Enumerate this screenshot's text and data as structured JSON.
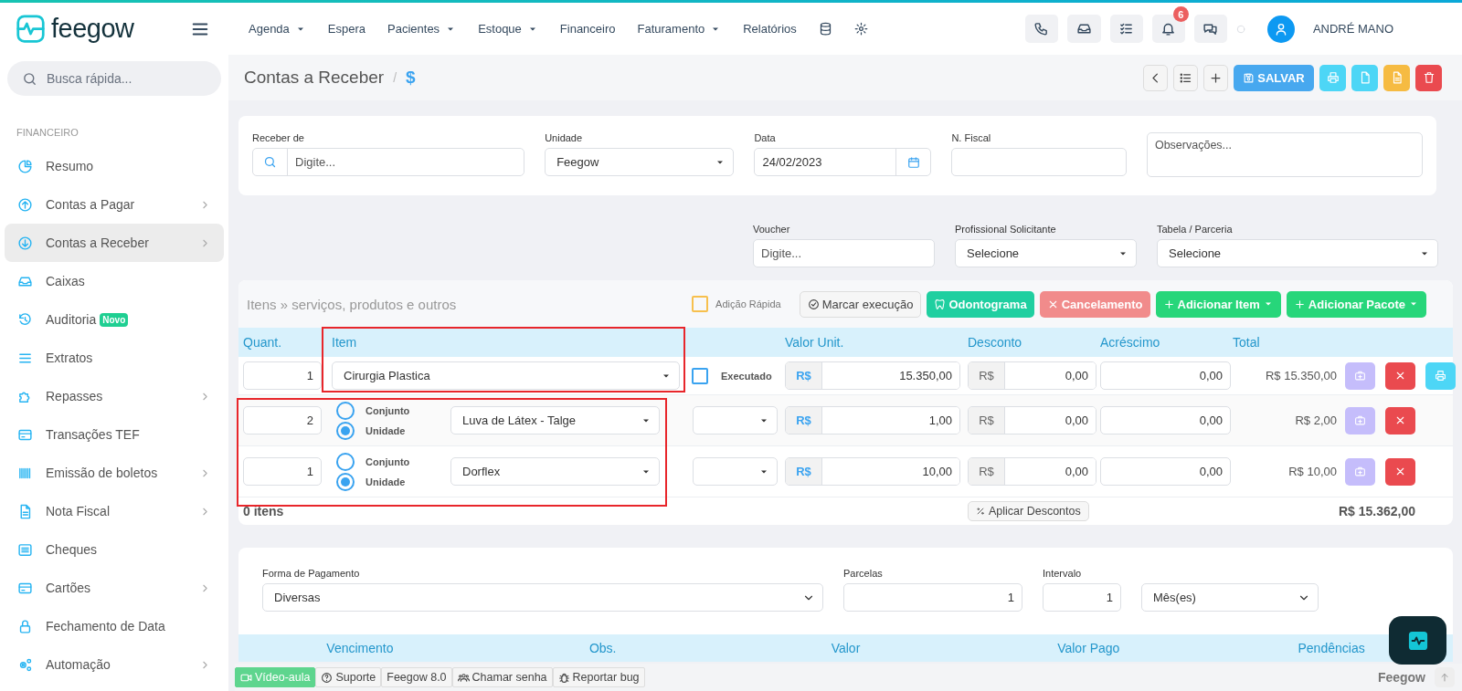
{
  "header": {
    "logo": "feegow",
    "nav": [
      {
        "label": "Agenda",
        "dropdown": true
      },
      {
        "label": "Espera",
        "dropdown": false
      },
      {
        "label": "Pacientes",
        "dropdown": true
      },
      {
        "label": "Estoque",
        "dropdown": true
      },
      {
        "label": "Financeiro",
        "dropdown": false
      },
      {
        "label": "Faturamento",
        "dropdown": true
      },
      {
        "label": "Relatórios",
        "dropdown": false
      }
    ],
    "notification_count": "6",
    "user": "ANDRÉ MANO"
  },
  "sidebar": {
    "search_placeholder": "Busca rápida...",
    "section": "FINANCEIRO",
    "items": [
      {
        "label": "Resumo",
        "selected": false,
        "submenu": false
      },
      {
        "label": "Contas a Pagar",
        "selected": false,
        "submenu": true
      },
      {
        "label": "Contas a Receber",
        "selected": true,
        "submenu": true
      },
      {
        "label": "Caixas",
        "selected": false,
        "submenu": false
      },
      {
        "label": "Auditoria",
        "selected": false,
        "submenu": false,
        "badge": "Novo"
      },
      {
        "label": "Extratos",
        "selected": false,
        "submenu": false
      },
      {
        "label": "Repasses",
        "selected": false,
        "submenu": true
      },
      {
        "label": "Transações TEF",
        "selected": false,
        "submenu": false
      },
      {
        "label": "Emissão de boletos",
        "selected": false,
        "submenu": true
      },
      {
        "label": "Nota Fiscal",
        "selected": false,
        "submenu": true
      },
      {
        "label": "Cheques",
        "selected": false,
        "submenu": false
      },
      {
        "label": "Cartões",
        "selected": false,
        "submenu": true
      },
      {
        "label": "Fechamento de Data",
        "selected": false,
        "submenu": false
      },
      {
        "label": "Automação",
        "selected": false,
        "submenu": true
      }
    ]
  },
  "breadcrumb": {
    "title": "Contas a Receber",
    "separator": "/",
    "current": "$"
  },
  "toolbar": {
    "save_label": "SALVAR"
  },
  "receipt_form": {
    "fields": [
      {
        "label": "Receber de",
        "kind": "search",
        "placeholder": "Digite..."
      },
      {
        "label": "Unidade",
        "kind": "select",
        "value": "Feegow"
      },
      {
        "label": "Data",
        "kind": "date",
        "value": "24/02/2023"
      },
      {
        "label": "N. Fiscal",
        "kind": "text"
      },
      {
        "kind": "textarea",
        "placeholder": "Observações..."
      }
    ]
  },
  "extra_fields": [
    {
      "label": "Voucher",
      "kind": "text",
      "placeholder": "Digite..."
    },
    {
      "label": "Profissional Solicitante",
      "kind": "select",
      "value": "Selecione"
    },
    {
      "label": "Tabela / Parceria",
      "kind": "select",
      "value": "Selecione"
    }
  ],
  "items": {
    "title": "Itens » serviços, produtos e outros",
    "quick_add": {
      "label": "Adição Rápida",
      "checked": false
    },
    "buttons": [
      {
        "label": "Marcar execução",
        "kind": "mark",
        "dropdown": false
      },
      {
        "label": "Odontograma",
        "kind": "tooth",
        "dropdown": false
      },
      {
        "label": "Cancelamento",
        "kind": "cancel",
        "dropdown": false
      },
      {
        "label": "Adicionar Item",
        "kind": "add",
        "dropdown": true
      },
      {
        "label": "Adicionar Pacote",
        "kind": "add",
        "dropdown": true
      }
    ],
    "columns": [
      "Quant.",
      "Item",
      "Valor Unit.",
      "Desconto",
      "Acréscimo",
      "Total"
    ],
    "rows": [
      {
        "kind": "service",
        "quantity": "1",
        "item": "Cirurgia Plastica",
        "executed": false,
        "executed_label": "Executado",
        "currency": "R$",
        "unit_value": "15.350,00",
        "discount_currency": "R$",
        "discount": "0,00",
        "surcharge": "0,00",
        "total": "R$ 15.350,00",
        "actions": [
          {
            "kind": "kit"
          },
          {
            "kind": "remove"
          },
          {
            "kind": "print"
          }
        ]
      },
      {
        "kind": "product",
        "quantity": "2",
        "options": [
          {
            "label": "Conjunto",
            "selected": false
          },
          {
            "label": "Unidade",
            "selected": true
          }
        ],
        "product": "Luva de Látex - Talge",
        "currency": "R$",
        "unit_value": "1,00",
        "discount_currency": "R$",
        "discount": "0,00",
        "surcharge": "0,00",
        "total": "R$ 2,00",
        "actions": [
          {
            "kind": "kit"
          },
          {
            "kind": "remove"
          }
        ]
      },
      {
        "kind": "product",
        "quantity": "1",
        "options": [
          {
            "label": "Conjunto",
            "selected": false
          },
          {
            "label": "Unidade",
            "selected": true
          }
        ],
        "product": "Dorflex",
        "currency": "R$",
        "unit_value": "10,00",
        "discount_currency": "R$",
        "discount": "0,00",
        "surcharge": "0,00",
        "total": "R$ 10,00",
        "actions": [
          {
            "kind": "kit"
          },
          {
            "kind": "remove"
          }
        ]
      }
    ],
    "count": "0 itens",
    "apply_label": "Aplicar Descontos",
    "grand_total": "R$ 15.362,00",
    "highlights": {
      "item_column": true,
      "product_rows": true
    }
  },
  "payment": {
    "fields": [
      {
        "label": "Forma de Pagamento",
        "kind": "select",
        "value": "Diversas"
      },
      {
        "label": "Parcelas",
        "kind": "number",
        "value": "1"
      },
      {
        "label": "Intervalo",
        "kind": "number",
        "value": "1"
      },
      {
        "kind": "select",
        "value": "Mês(es)"
      }
    ],
    "columns": [
      "Vencimento",
      "Obs.",
      "Valor",
      "Valor Pago",
      "Pendências"
    ]
  },
  "footer": {
    "buttons": [
      {
        "label": "Vídeo-aula",
        "kind": "video"
      },
      {
        "label": "Suporte",
        "kind": "help"
      },
      {
        "label": "Feegow 8.0",
        "kind": "plain"
      },
      {
        "label": "Chamar senha",
        "kind": "users"
      },
      {
        "label": "Reportar bug",
        "kind": "bug"
      }
    ],
    "brand": "Feegow"
  }
}
